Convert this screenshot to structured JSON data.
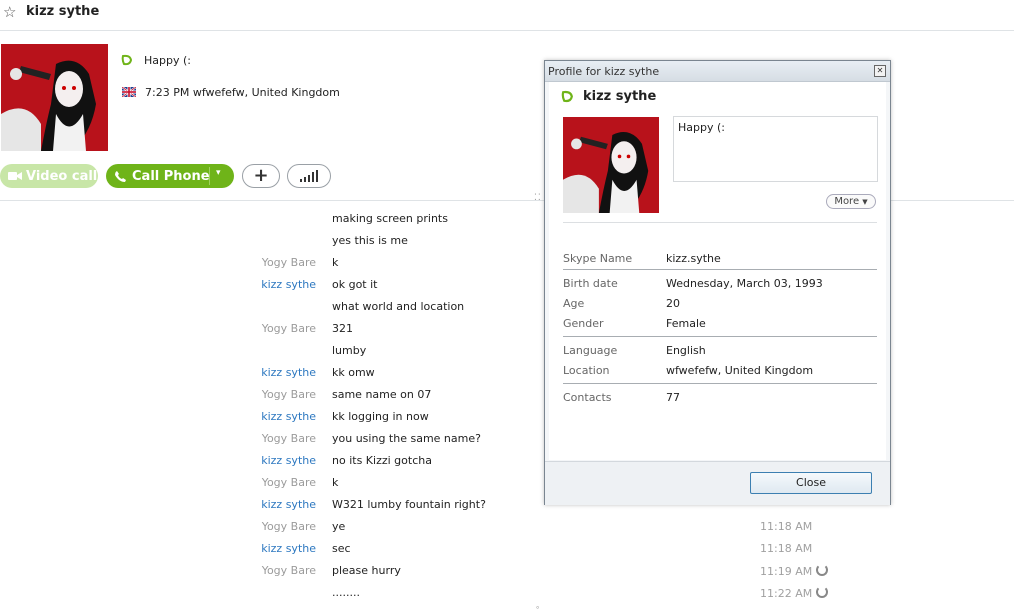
{
  "header": {
    "contact_name": "kizz sythe"
  },
  "profile": {
    "mood": "Happy (:",
    "local_info": "7:23 PM wfwefefw, United Kingdom"
  },
  "actions": {
    "video_call": "Video call",
    "call_phone": "Call Phone"
  },
  "colors": {
    "online_green": "#6fb419",
    "link_blue": "#2d78c0",
    "other_sender": "#9b9b9b"
  },
  "conversation": {
    "messages": [
      {
        "sender": "",
        "role": "me",
        "text": "making screen prints",
        "time": ""
      },
      {
        "sender": "",
        "role": "me",
        "text": "yes this is me",
        "time": ""
      },
      {
        "sender": "Yogy Bare",
        "role": "other",
        "text": "k",
        "time": ""
      },
      {
        "sender": "kizz sythe",
        "role": "me",
        "text": "ok got it",
        "time": ""
      },
      {
        "sender": "",
        "role": "me",
        "text": "what world and location",
        "time": ""
      },
      {
        "sender": "Yogy Bare",
        "role": "other",
        "text": "321",
        "time": ""
      },
      {
        "sender": "",
        "role": "other",
        "text": "lumby",
        "time": ""
      },
      {
        "sender": "kizz sythe",
        "role": "me",
        "text": "kk omw",
        "time": ""
      },
      {
        "sender": "Yogy Bare",
        "role": "other",
        "text": "same name on 07",
        "time": ""
      },
      {
        "sender": "kizz sythe",
        "role": "me",
        "text": "kk logging in now",
        "time": ""
      },
      {
        "sender": "Yogy Bare",
        "role": "other",
        "text": "you using the same name?",
        "time": ""
      },
      {
        "sender": "kizz sythe",
        "role": "me",
        "text": "no its Kizzi gotcha",
        "time": ""
      },
      {
        "sender": "Yogy Bare",
        "role": "other",
        "text": "k",
        "time": ""
      },
      {
        "sender": "kizz sythe",
        "role": "me",
        "text": "W321 lumby fountain right?",
        "time": ""
      },
      {
        "sender": "Yogy Bare",
        "role": "other",
        "text": "ye",
        "time": "11:18 AM"
      },
      {
        "sender": "kizz sythe",
        "role": "me",
        "text": "sec",
        "time": "11:18 AM"
      },
      {
        "sender": "Yogy Bare",
        "role": "other",
        "text": "please hurry",
        "time": "11:19 AM"
      },
      {
        "sender": "",
        "role": "other",
        "text": "........",
        "time": "11:22 AM"
      }
    ]
  },
  "dialog": {
    "title": "Profile for kizz sythe",
    "name": "kizz sythe",
    "mood": "Happy (:",
    "more_label": "More",
    "fields": {
      "skype_name_label": "Skype Name",
      "skype_name": "kizz.sythe",
      "birth_date_label": "Birth date",
      "birth_date": "Wednesday, March 03, 1993",
      "age_label": "Age",
      "age": "20",
      "gender_label": "Gender",
      "gender": "Female",
      "language_label": "Language",
      "language": "English",
      "location_label": "Location",
      "location": "wfwefefw, United Kingdom",
      "contacts_label": "Contacts",
      "contacts": "77"
    },
    "close_label": "Close"
  }
}
